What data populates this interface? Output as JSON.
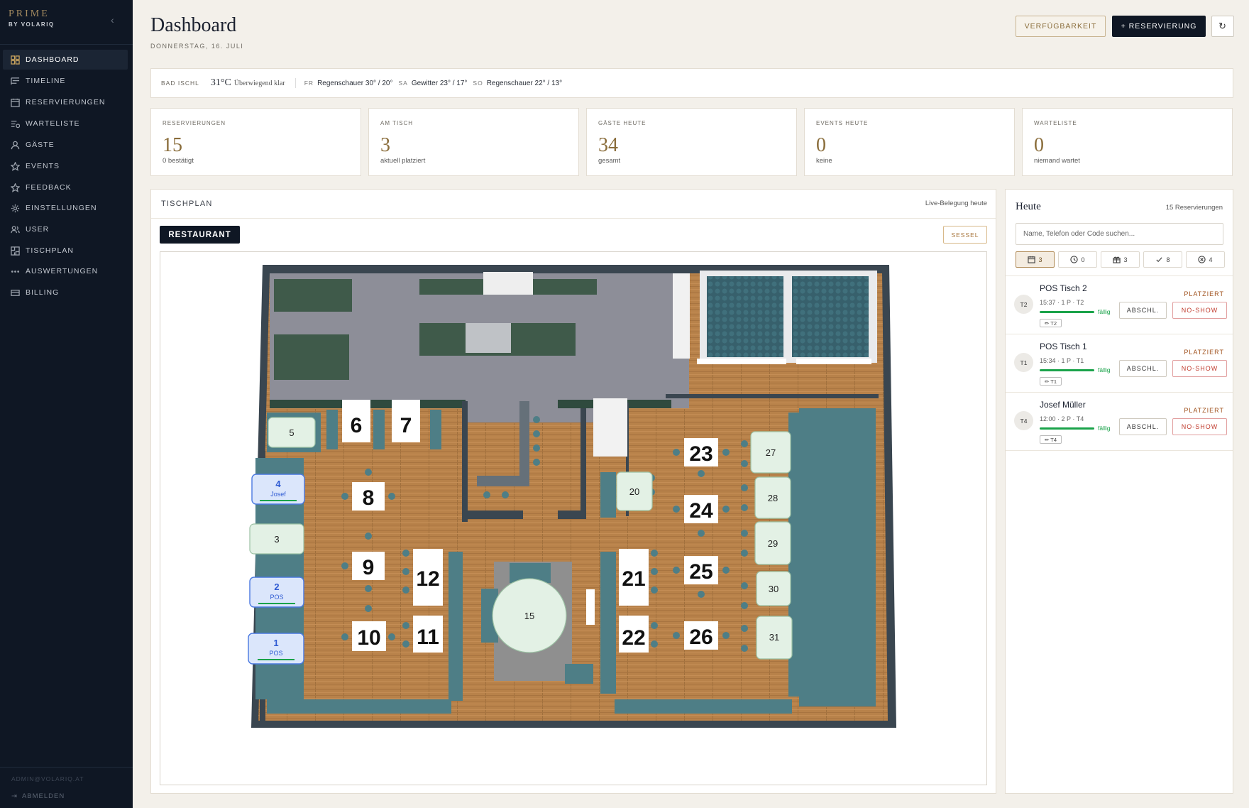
{
  "brand": {
    "name": "PRIME",
    "sub": "BY VOLARIQ"
  },
  "sidebar": {
    "items": [
      {
        "label": "DASHBOARD",
        "icon": "grid-icon"
      },
      {
        "label": "TIMELINE",
        "icon": "timeline-icon"
      },
      {
        "label": "RESERVIERUNGEN",
        "icon": "calendar-icon"
      },
      {
        "label": "WARTELISTE",
        "icon": "list-clock-icon"
      },
      {
        "label": "GÄSTE",
        "icon": "person-icon"
      },
      {
        "label": "EVENTS",
        "icon": "star-icon"
      },
      {
        "label": "FEEDBACK",
        "icon": "star-outline-icon"
      },
      {
        "label": "EINSTELLUNGEN",
        "icon": "gear-icon"
      },
      {
        "label": "USER",
        "icon": "users-icon"
      },
      {
        "label": "TISCHPLAN",
        "icon": "floorplan-icon"
      },
      {
        "label": "AUSWERTUNGEN",
        "icon": "dots-icon"
      },
      {
        "label": "BILLING",
        "icon": "card-icon"
      }
    ],
    "user_email": "ADMIN@VOLARIQ.AT",
    "logout": "ABMELDEN"
  },
  "header": {
    "title": "Dashboard",
    "date": "DONNERSTAG, 16. JULI",
    "btn_availability": "VERFÜGBARKEIT",
    "btn_reservation": "+ RESERVIERUNG",
    "btn_refresh": "↻"
  },
  "weather": {
    "location": "BAD ISCHL",
    "temp": "31°C",
    "condition": "Überwiegend klar",
    "forecast": [
      {
        "day": "FR",
        "text": "Regenschauer 30° / 20°"
      },
      {
        "day": "SA",
        "text": "Gewitter 23° / 17°"
      },
      {
        "day": "SO",
        "text": "Regenschauer 22° / 13°"
      }
    ]
  },
  "stats": [
    {
      "label": "RESERVIERUNGEN",
      "value": "15",
      "sub": "0 bestätigt"
    },
    {
      "label": "AM TISCH",
      "value": "3",
      "sub": "aktuell platziert"
    },
    {
      "label": "GÄSTE HEUTE",
      "value": "34",
      "sub": "gesamt"
    },
    {
      "label": "EVENTS HEUTE",
      "value": "0",
      "sub": "keine"
    },
    {
      "label": "WARTELISTE",
      "value": "0",
      "sub": "niemand wartet"
    }
  ],
  "tischplan": {
    "title": "TISCHPLAN",
    "live": "Live-Belegung heute",
    "tab": "RESTAURANT",
    "btn_sessel": "SESSEL",
    "printed_numbers": [
      "6",
      "7",
      "8",
      "9",
      "10",
      "11",
      "12",
      "21",
      "22",
      "23",
      "24",
      "25",
      "26"
    ],
    "tables": [
      {
        "number": "1",
        "label": "POS",
        "occupied": true
      },
      {
        "number": "2",
        "label": "POS",
        "occupied": true
      },
      {
        "number": "3",
        "label": "",
        "occupied": false
      },
      {
        "number": "4",
        "label": "Josef",
        "occupied": true
      },
      {
        "number": "5",
        "label": "",
        "occupied": false
      },
      {
        "number": "15",
        "label": "",
        "occupied": false
      },
      {
        "number": "20",
        "label": "",
        "occupied": false
      },
      {
        "number": "27",
        "label": "",
        "occupied": false
      },
      {
        "number": "28",
        "label": "",
        "occupied": false
      },
      {
        "number": "29",
        "label": "",
        "occupied": false
      },
      {
        "number": "30",
        "label": "",
        "occupied": false
      },
      {
        "number": "31",
        "label": "",
        "occupied": false
      }
    ]
  },
  "panel": {
    "title": "Heute",
    "count": "15 Reservierungen",
    "search_placeholder": "Name, Telefon oder Code suchen...",
    "filters": [
      {
        "icon": "calendar-icon",
        "count": "3"
      },
      {
        "icon": "clock-icon",
        "count": "0"
      },
      {
        "icon": "gift-icon",
        "count": "3"
      },
      {
        "icon": "check-icon",
        "count": "8"
      },
      {
        "icon": "x-circle-icon",
        "count": "4"
      }
    ],
    "reservations": [
      {
        "avatar": "T2",
        "name": "POS Tisch 2",
        "status": "PLATZIERT",
        "meta": "15:37 · 1 P · T2",
        "due": "fällig",
        "tag": "✏ T2",
        "btn_finish": "ABSCHL.",
        "btn_noshow": "NO-SHOW"
      },
      {
        "avatar": "T1",
        "name": "POS Tisch 1",
        "status": "PLATZIERT",
        "meta": "15:34 · 1 P · T1",
        "due": "fällig",
        "tag": "✏ T1",
        "btn_finish": "ABSCHL.",
        "btn_noshow": "NO-SHOW"
      },
      {
        "avatar": "T4",
        "name": "Josef Müller",
        "status": "PLATZIERT",
        "meta": "12:00 · 2 P · T4",
        "due": "fällig",
        "tag": "✏ T4",
        "btn_finish": "ABSCHL.",
        "btn_noshow": "NO-SHOW"
      }
    ]
  },
  "colors": {
    "sidebar": "#0f1724",
    "accent": "#8a6d3b",
    "occupied": "#2f5bd3",
    "free_table": "#e6f2e8",
    "due": "#1aa34a",
    "noshow": "#c0392b"
  }
}
